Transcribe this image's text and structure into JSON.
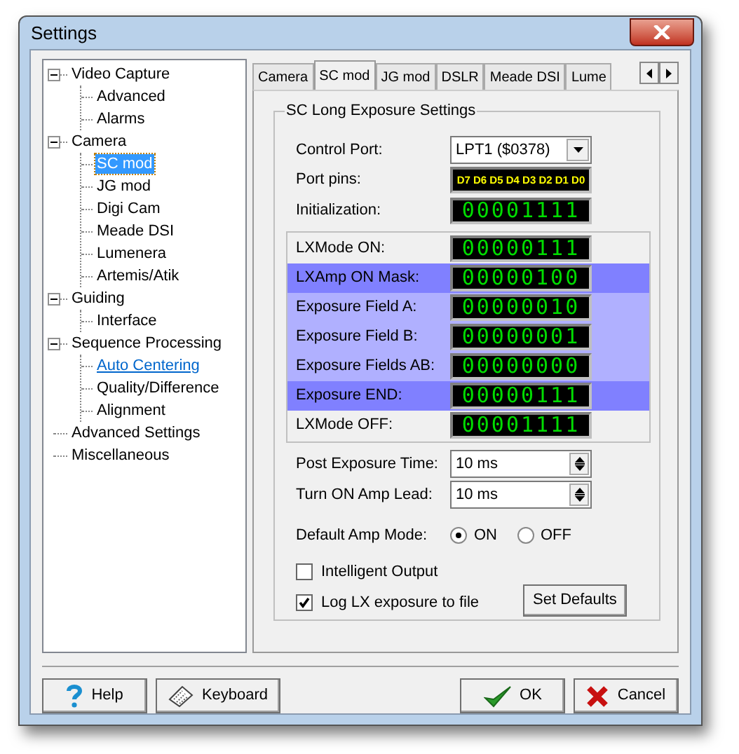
{
  "window": {
    "title": "Settings"
  },
  "tree": [
    {
      "label": "Video Capture",
      "expanded": true,
      "selected": false,
      "hovered": false,
      "children": [
        {
          "label": "Advanced",
          "selected": false,
          "hovered": false
        },
        {
          "label": "Alarms",
          "selected": false,
          "hovered": false
        }
      ]
    },
    {
      "label": "Camera",
      "expanded": true,
      "selected": false,
      "hovered": false,
      "children": [
        {
          "label": "SC mod",
          "selected": true,
          "hovered": false
        },
        {
          "label": "JG mod",
          "selected": false,
          "hovered": false
        },
        {
          "label": "Digi Cam",
          "selected": false,
          "hovered": false
        },
        {
          "label": "Meade DSI",
          "selected": false,
          "hovered": false
        },
        {
          "label": "Lumenera",
          "selected": false,
          "hovered": false
        },
        {
          "label": "Artemis/Atik",
          "selected": false,
          "hovered": false
        }
      ]
    },
    {
      "label": "Guiding",
      "expanded": true,
      "selected": false,
      "hovered": false,
      "children": [
        {
          "label": "Interface",
          "selected": false,
          "hovered": false
        }
      ]
    },
    {
      "label": "Sequence Processing",
      "expanded": true,
      "selected": false,
      "hovered": false,
      "children": [
        {
          "label": "Auto Centering",
          "selected": false,
          "hovered": true
        },
        {
          "label": "Quality/Difference",
          "selected": false,
          "hovered": false
        },
        {
          "label": "Alignment",
          "selected": false,
          "hovered": false
        }
      ]
    },
    {
      "label": "Advanced Settings",
      "selected": false,
      "hovered": false
    },
    {
      "label": "Miscellaneous",
      "selected": false,
      "hovered": false
    }
  ],
  "tabs": [
    {
      "label": "Camera",
      "selected": false
    },
    {
      "label": "SC mod",
      "selected": true
    },
    {
      "label": "JG mod",
      "selected": false
    },
    {
      "label": "DSLR",
      "selected": false
    },
    {
      "label": "Meade DSI",
      "selected": false
    },
    {
      "label": "Lume",
      "selected": false
    }
  ],
  "group": {
    "title": "SC Long Exposure Settings",
    "control_port": {
      "label": "Control Port:",
      "value": "LPT1 ($0378)"
    },
    "port_pins": {
      "label": "Port pins:",
      "value": "D7 D6 D5 D4 D3 D2 D1 D0"
    },
    "initialization": {
      "label": "Initialization:",
      "value": "00001111"
    },
    "bit_rows": [
      {
        "label": "LXMode ON:",
        "value": "00000111"
      },
      {
        "label": "LXAmp ON Mask:",
        "value": "00000100",
        "color": "#8080ff"
      },
      {
        "label": "Exposure Field A:",
        "value": "00000010",
        "color": "#b0b0ff"
      },
      {
        "label": "Exposure Field B:",
        "value": "00000001",
        "color": "#b0b0ff"
      },
      {
        "label": "Exposure Fields AB:",
        "value": "00000000",
        "color": "#b0b0ff"
      },
      {
        "label": "Exposure END:",
        "value": "00000111",
        "color": "#8080ff"
      },
      {
        "label": "LXMode OFF:",
        "value": "00001111"
      }
    ],
    "spinners": [
      {
        "label": "Post Exposure Time:",
        "value": "10 ms"
      },
      {
        "label": "Turn ON Amp Lead:",
        "value": "10 ms"
      }
    ],
    "amp_mode": {
      "label": "Default Amp Mode:",
      "options": [
        {
          "label": "ON",
          "selected": true
        },
        {
          "label": "OFF",
          "selected": false
        }
      ]
    },
    "checkboxes": [
      {
        "label": "Intelligent Output",
        "checked": false
      },
      {
        "label": "Log LX exposure to file",
        "checked": true
      }
    ],
    "set_defaults": "Set Defaults"
  },
  "buttons": [
    {
      "kind": "help",
      "label": "Help"
    },
    {
      "kind": "keyboard",
      "label": "Keyboard"
    },
    {
      "kind": "ok",
      "label": "OK"
    },
    {
      "kind": "cancel",
      "label": "Cancel"
    }
  ]
}
